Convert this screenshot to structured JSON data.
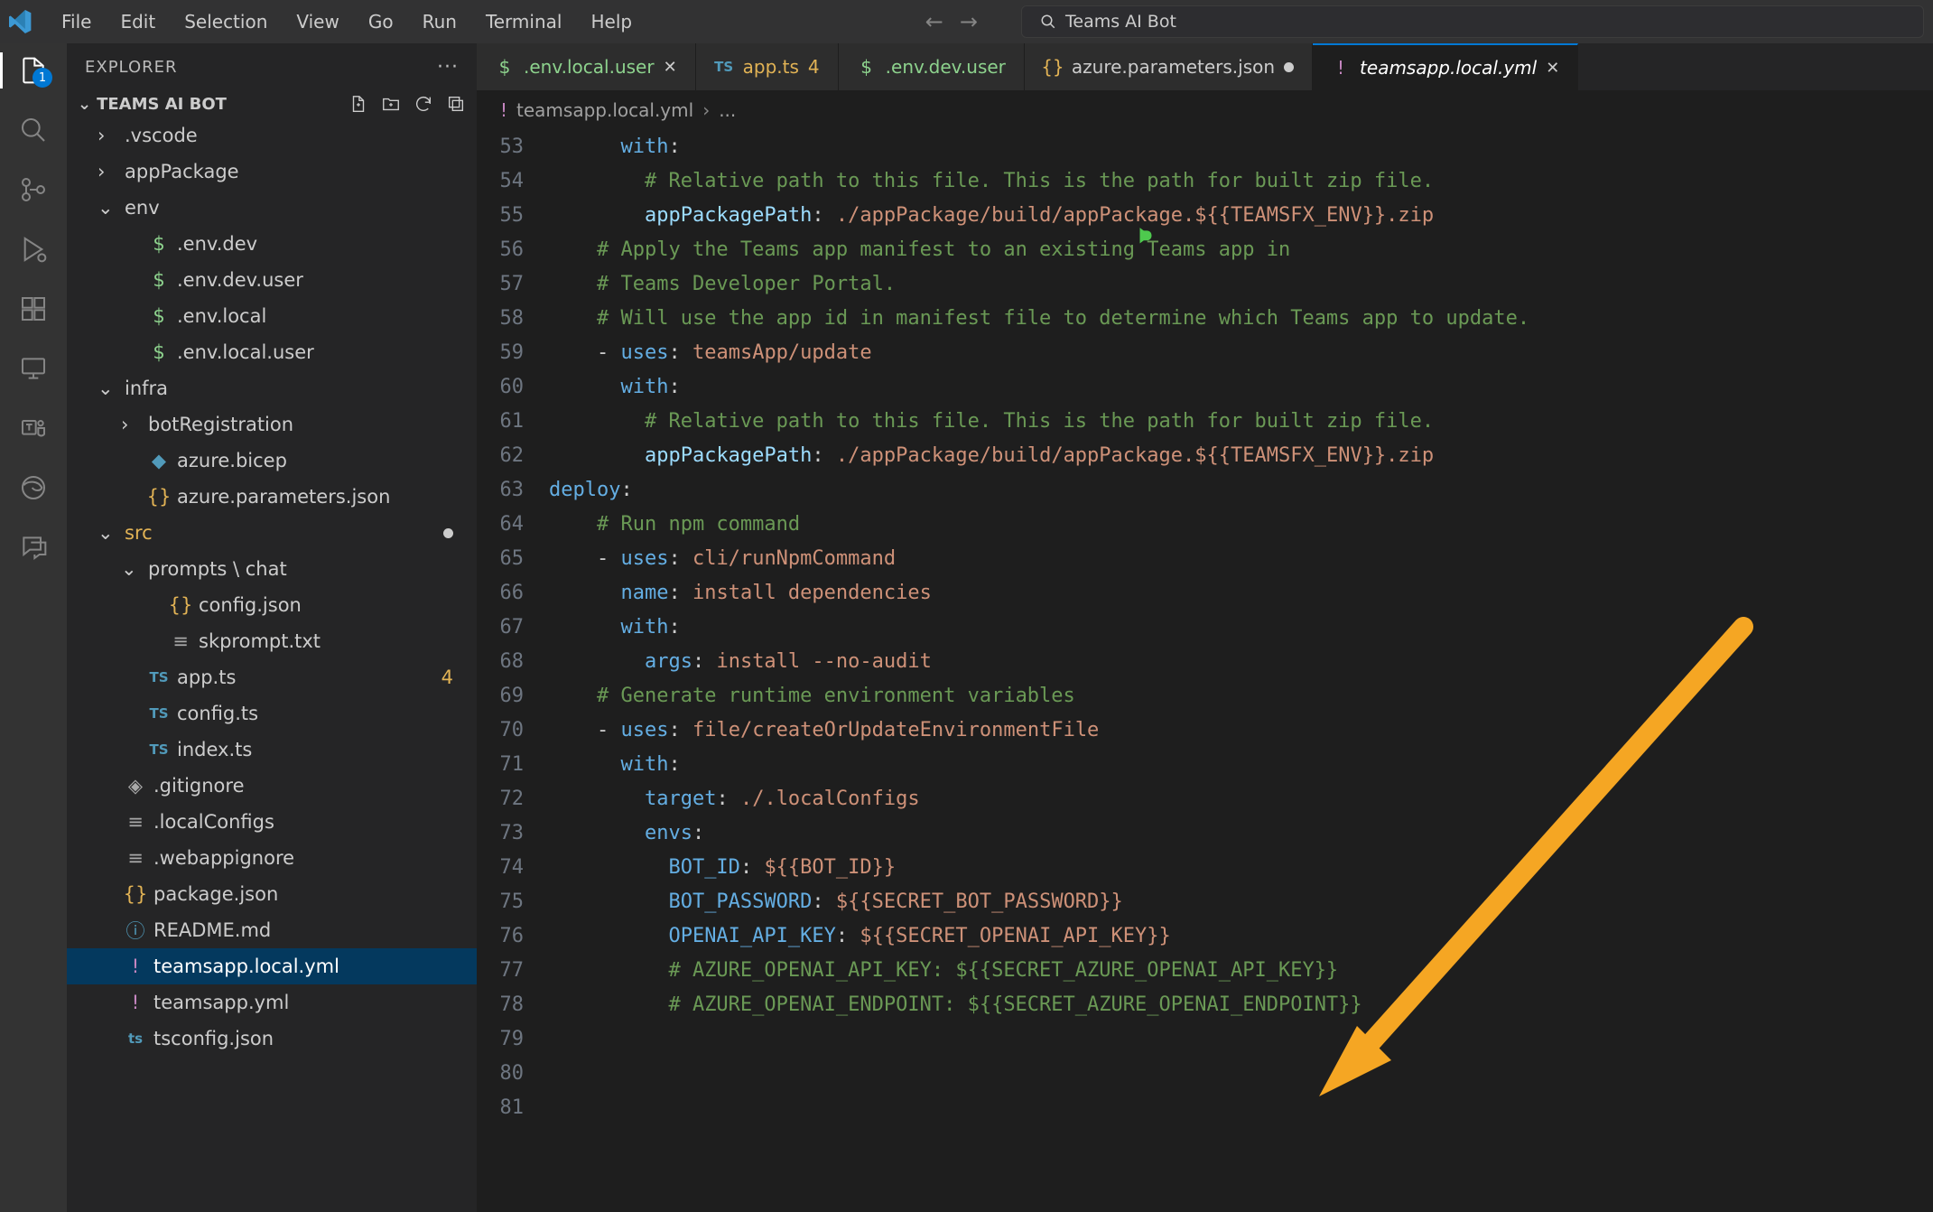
{
  "menu": [
    "File",
    "Edit",
    "Selection",
    "View",
    "Go",
    "Run",
    "Terminal",
    "Help"
  ],
  "search_placeholder": "Teams AI Bot",
  "activity_badge": "1",
  "explorer": {
    "title": "EXPLORER",
    "folder": "TEAMS AI BOT"
  },
  "tree": [
    {
      "d": 1,
      "chev": ">",
      "icon": "folder",
      "name": ".vscode"
    },
    {
      "d": 1,
      "chev": ">",
      "icon": "folder",
      "name": "appPackage"
    },
    {
      "d": 1,
      "chev": "v",
      "icon": "folder",
      "name": "env"
    },
    {
      "d": 2,
      "icon": "dollar",
      "name": ".env.dev"
    },
    {
      "d": 2,
      "icon": "dollar",
      "name": ".env.dev.user"
    },
    {
      "d": 2,
      "icon": "dollar",
      "name": ".env.local"
    },
    {
      "d": 2,
      "icon": "dollar",
      "name": ".env.local.user"
    },
    {
      "d": 1,
      "chev": "v",
      "icon": "folder",
      "name": "infra"
    },
    {
      "d": 2,
      "chev": ">",
      "icon": "folder",
      "name": "botRegistration"
    },
    {
      "d": 2,
      "icon": "bicep",
      "name": "azure.bicep"
    },
    {
      "d": 2,
      "icon": "brace",
      "name": "azure.parameters.json"
    },
    {
      "d": 1,
      "chev": "v",
      "icon": "folder",
      "name": "src",
      "src": true,
      "dirty": true
    },
    {
      "d": 2,
      "chev": "v",
      "icon": "folder",
      "name": "prompts \\ chat"
    },
    {
      "d": 3,
      "icon": "brace",
      "name": "config.json"
    },
    {
      "d": 3,
      "icon": "lines",
      "name": "skprompt.txt"
    },
    {
      "d": 2,
      "icon": "ts",
      "name": "app.ts",
      "badge": "4"
    },
    {
      "d": 2,
      "icon": "ts",
      "name": "config.ts"
    },
    {
      "d": 2,
      "icon": "ts",
      "name": "index.ts"
    },
    {
      "d": 1,
      "icon": "diamond",
      "name": ".gitignore"
    },
    {
      "d": 1,
      "icon": "lines",
      "name": ".localConfigs"
    },
    {
      "d": 1,
      "icon": "lines",
      "name": ".webappignore"
    },
    {
      "d": 1,
      "icon": "brace",
      "name": "package.json"
    },
    {
      "d": 1,
      "icon": "info",
      "name": "README.md"
    },
    {
      "d": 1,
      "icon": "bang",
      "name": "teamsapp.local.yml",
      "selected": true
    },
    {
      "d": 1,
      "icon": "bang",
      "name": "teamsapp.yml"
    },
    {
      "d": 1,
      "icon": "tsbox",
      "name": "tsconfig.json"
    }
  ],
  "tabs": [
    {
      "icon": "dollar",
      "name": ".env.local.user",
      "class": "git",
      "close": true
    },
    {
      "icon": "ts",
      "name": "app.ts",
      "class": "mod",
      "badge": "4"
    },
    {
      "icon": "dollar",
      "name": ".env.dev.user",
      "class": "git"
    },
    {
      "icon": "brace",
      "name": "azure.parameters.json",
      "dirty": true
    },
    {
      "icon": "bang",
      "name": "teamsapp.local.yml",
      "class": "active",
      "active": true,
      "close": true
    }
  ],
  "breadcrumb": {
    "icon": "bang",
    "file": "teamsapp.local.yml",
    "rest": "..."
  },
  "code": {
    "start": 53,
    "lines": [
      [
        [
          "      ",
          ""
        ],
        [
          "with",
          1
        ],
        [
          ":",
          0
        ]
      ],
      [
        [
          "        ",
          ""
        ],
        [
          "# Relative path to this file. This is the path for built zip file.",
          2
        ]
      ],
      [
        [
          "        ",
          ""
        ],
        [
          "appPackagePath",
          3
        ],
        [
          ": ",
          0
        ],
        [
          "./appPackage/build/appPackage.${{TEAMSFX_ENV}}.zip",
          4
        ]
      ],
      [
        [
          "",
          0
        ]
      ],
      [
        [
          "    ",
          ""
        ],
        [
          "# Apply the Teams app manifest to an existing Teams app in",
          2
        ]
      ],
      [
        [
          "    ",
          ""
        ],
        [
          "# Teams Developer Portal.",
          2
        ]
      ],
      [
        [
          "    ",
          ""
        ],
        [
          "# Will use the app id in manifest file to determine which Teams app to update.",
          2
        ]
      ],
      [
        [
          "    ",
          ""
        ],
        [
          "- ",
          0
        ],
        [
          "uses",
          1
        ],
        [
          ": ",
          0
        ],
        [
          "teamsApp/update",
          4
        ]
      ],
      [
        [
          "      ",
          ""
        ],
        [
          "with",
          1
        ],
        [
          ":",
          0
        ]
      ],
      [
        [
          "        ",
          ""
        ],
        [
          "# Relative path to this file. This is the path for built zip file.",
          2
        ]
      ],
      [
        [
          "        ",
          ""
        ],
        [
          "appPackagePath",
          3
        ],
        [
          ": ",
          0
        ],
        [
          "./appPackage/build/appPackage.${{TEAMSFX_ENV}}.zip",
          4
        ]
      ],
      [
        [
          "",
          0
        ]
      ],
      [
        [
          "",
          ""
        ],
        [
          "deploy",
          5
        ],
        [
          ":",
          0
        ]
      ],
      [
        [
          "    ",
          ""
        ],
        [
          "# Run npm command",
          2
        ]
      ],
      [
        [
          "    ",
          ""
        ],
        [
          "- ",
          0
        ],
        [
          "uses",
          1
        ],
        [
          ": ",
          0
        ],
        [
          "cli/runNpmCommand",
          4
        ]
      ],
      [
        [
          "      ",
          ""
        ],
        [
          "name",
          1
        ],
        [
          ": ",
          0
        ],
        [
          "install dependencies",
          4
        ]
      ],
      [
        [
          "      ",
          ""
        ],
        [
          "with",
          1
        ],
        [
          ":",
          0
        ]
      ],
      [
        [
          "        ",
          ""
        ],
        [
          "args",
          1
        ],
        [
          ": ",
          0
        ],
        [
          "install --no-audit",
          4
        ]
      ],
      [
        [
          "",
          0
        ]
      ],
      [
        [
          "    ",
          ""
        ],
        [
          "# Generate runtime environment variables",
          2
        ]
      ],
      [
        [
          "    ",
          ""
        ],
        [
          "- ",
          0
        ],
        [
          "uses",
          1
        ],
        [
          ": ",
          0
        ],
        [
          "file/createOrUpdateEnvironmentFile",
          4
        ]
      ],
      [
        [
          "      ",
          ""
        ],
        [
          "with",
          1
        ],
        [
          ":",
          0
        ]
      ],
      [
        [
          "        ",
          ""
        ],
        [
          "target",
          1
        ],
        [
          ": ",
          0
        ],
        [
          "./.localConfigs",
          4
        ]
      ],
      [
        [
          "        ",
          ""
        ],
        [
          "envs",
          1
        ],
        [
          ":",
          0
        ]
      ],
      [
        [
          "          ",
          ""
        ],
        [
          "BOT_ID",
          1
        ],
        [
          ": ",
          0
        ],
        [
          "${{BOT_ID}}",
          4
        ]
      ],
      [
        [
          "          ",
          ""
        ],
        [
          "BOT_PASSWORD",
          1
        ],
        [
          ": ",
          0
        ],
        [
          "${{SECRET_BOT_PASSWORD}}",
          4
        ]
      ],
      [
        [
          "          ",
          ""
        ],
        [
          "OPENAI_API_KEY",
          1
        ],
        [
          ": ",
          0
        ],
        [
          "${{SECRET_OPENAI_API_KEY}}",
          4
        ]
      ],
      [
        [
          "          ",
          ""
        ],
        [
          "# AZURE_OPENAI_API_KEY: ${{SECRET_AZURE_OPENAI_API_KEY}}",
          2
        ]
      ],
      [
        [
          "          ",
          ""
        ],
        [
          "# AZURE_OPENAI_ENDPOINT: ${{SECRET_AZURE_OPENAI_ENDPOINT}}",
          2
        ]
      ]
    ]
  }
}
